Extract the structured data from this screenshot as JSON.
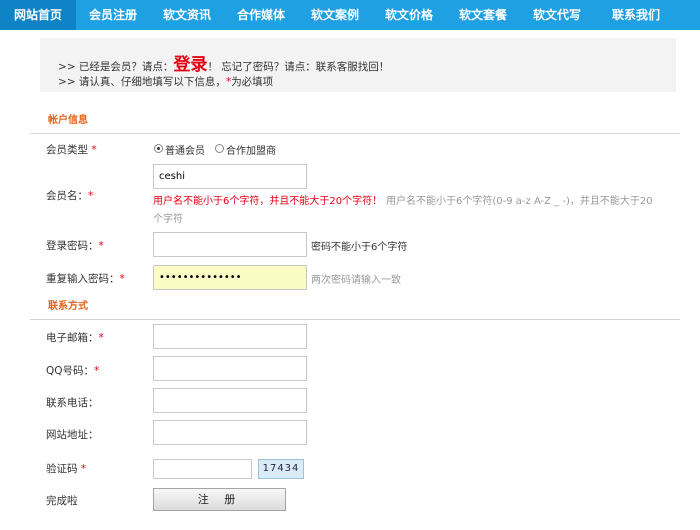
{
  "nav": {
    "items": [
      {
        "label": "网站首页",
        "active": true
      },
      {
        "label": "会员注册"
      },
      {
        "label": "软文资讯"
      },
      {
        "label": "合作媒体"
      },
      {
        "label": "软文案例"
      },
      {
        "label": "软文价格"
      },
      {
        "label": "软文套餐"
      },
      {
        "label": "软文代写"
      },
      {
        "label": "联系我们"
      }
    ]
  },
  "notice": {
    "line1_prefix": ">> 已经是会员？请点：",
    "login_link": "登录",
    "line1_middle": "！  忘记了密码？请点：",
    "line1_link": "联系客服找回！",
    "line2_prefix": ">> 请认真、仔细地填写以下信息，",
    "line2_star": "*",
    "line2_suffix": "为必填项"
  },
  "sections": {
    "account": "帐户信息",
    "contact": "联系方式"
  },
  "form": {
    "member_type": {
      "label": "会员类型",
      "options": [
        "普通会员",
        "合作加盟商"
      ],
      "selected": "普通会员"
    },
    "username": {
      "label": "会员名：",
      "value": "ceshi",
      "error": "用户名不能小于6个字符，并且不能大于20个字符！",
      "hint_line1": "用户名不能小于6个字符(0-9 a-z A-Z _ -)，并且不能大于20",
      "hint_line2": "个字符"
    },
    "password": {
      "label": "登录密码：",
      "value": "",
      "hint": "密码不能小于6个字符"
    },
    "password_confirm": {
      "label": "重复输入密码：",
      "value": "••••••••••••••",
      "hint": "两次密码请输入一致"
    },
    "email": {
      "label": "电子邮箱：",
      "value": ""
    },
    "qq": {
      "label": "QQ号码：",
      "value": ""
    },
    "phone": {
      "label": "联系电话：",
      "value": ""
    },
    "website": {
      "label": "网站地址：",
      "value": ""
    },
    "captcha": {
      "label": "验证码",
      "value": "",
      "code": "17434"
    },
    "finish": {
      "label": "完成啦"
    },
    "submit_label": "注 册"
  },
  "required_mark": "*",
  "colors": {
    "nav_bg": "#1ea0e2",
    "nav_active": "#0e84c6",
    "section_title": "#e5641d",
    "required": "#e60012",
    "autofill_bg": "#fbfbc6"
  }
}
